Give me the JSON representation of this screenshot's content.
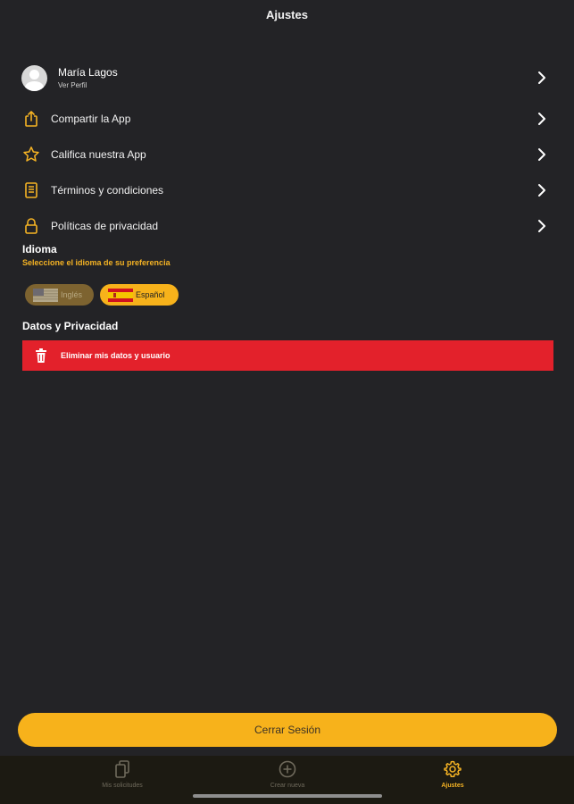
{
  "header": {
    "title": "Ajustes"
  },
  "profile": {
    "name": "María Lagos",
    "subtitle": "Ver Perfil"
  },
  "menu": [
    {
      "label": "Compartir la App",
      "icon": "share-icon"
    },
    {
      "label": "Califica nuestra App",
      "icon": "star-icon"
    },
    {
      "label": "Términos y condiciones",
      "icon": "document-icon"
    },
    {
      "label": "Políticas de privacidad",
      "icon": "lock-icon"
    }
  ],
  "language": {
    "title": "Idioma",
    "subtitle": "Seleccione el idioma de su preferencia",
    "options": [
      {
        "label": "Inglés",
        "flag": "us-flag-icon",
        "selected": false
      },
      {
        "label": "Español",
        "flag": "spain-flag-icon",
        "selected": true
      }
    ]
  },
  "privacy": {
    "title": "Datos y Privacidad",
    "delete_label": "Eliminar mis datos y usuario"
  },
  "logout_label": "Cerrar Sesión",
  "tabs": [
    {
      "label": "Mis solicitudes",
      "icon": "documents-icon",
      "active": false
    },
    {
      "label": "Crear nueva",
      "icon": "plus-circle-icon",
      "active": false
    },
    {
      "label": "Ajustes",
      "icon": "gear-icon",
      "active": true
    }
  ],
  "colors": {
    "background": "#232326",
    "accent": "#f5b324",
    "danger": "#e3212b",
    "tabbar": "#1c1a12"
  }
}
